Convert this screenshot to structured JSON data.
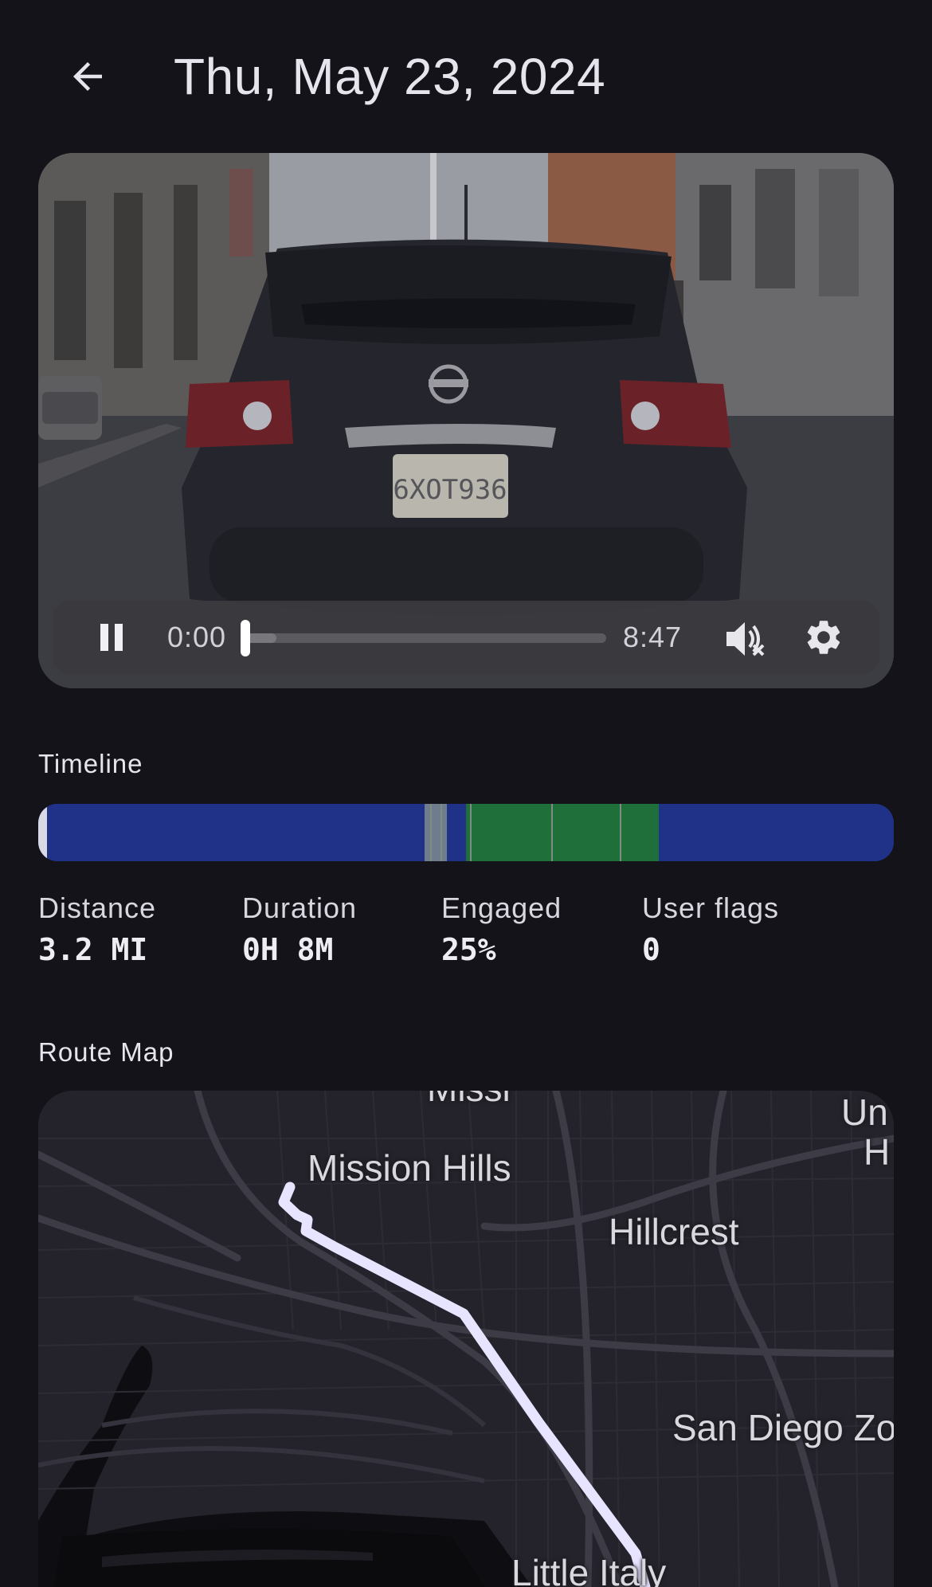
{
  "header": {
    "title": "Thu, May 23, 2024",
    "back_icon": "arrow-left-icon"
  },
  "player": {
    "current_time": "0:00",
    "duration": "8:47",
    "progress": 0.0,
    "buffered": 0.09,
    "muted": true,
    "icons": {
      "pause": "pause-icon",
      "mute": "volume-muted-icon",
      "settings": "gear-icon"
    },
    "plate_text": "6XOT936"
  },
  "timeline": {
    "label": "Timeline",
    "segments": [
      {
        "start": 0.0,
        "end": 0.01,
        "color": "#d9d9e6",
        "kind": "start-marker"
      },
      {
        "start": 0.01,
        "end": 0.452,
        "color": "#203188",
        "kind": "driving"
      },
      {
        "start": 0.452,
        "end": 0.478,
        "color": "#6f7c8c",
        "kind": "gray"
      },
      {
        "start": 0.478,
        "end": 0.5,
        "color": "#203188",
        "kind": "driving"
      },
      {
        "start": 0.5,
        "end": 0.725,
        "color": "#1f6f3a",
        "kind": "engaged"
      },
      {
        "start": 0.725,
        "end": 1.0,
        "color": "#203188",
        "kind": "driving"
      }
    ],
    "ticks": [
      0.458,
      0.47,
      0.505,
      0.6,
      0.68
    ]
  },
  "stats": [
    {
      "label": "Distance",
      "value": "3.2 MI"
    },
    {
      "label": "Duration",
      "value": "0H 8M"
    },
    {
      "label": "Engaged",
      "value": "25%"
    },
    {
      "label": "User flags",
      "value": "0"
    }
  ],
  "map": {
    "label": "Route Map",
    "places": {
      "mission_hills": "Mission Hills",
      "hillcrest": "Hillcrest",
      "san_diego_zoo": "San Diego Zo",
      "little_italy": "Little Italy",
      "partial_top": "Missi",
      "partial_right_1": "Un",
      "partial_right_2": "H"
    },
    "route_color": "#e7e4ff"
  }
}
